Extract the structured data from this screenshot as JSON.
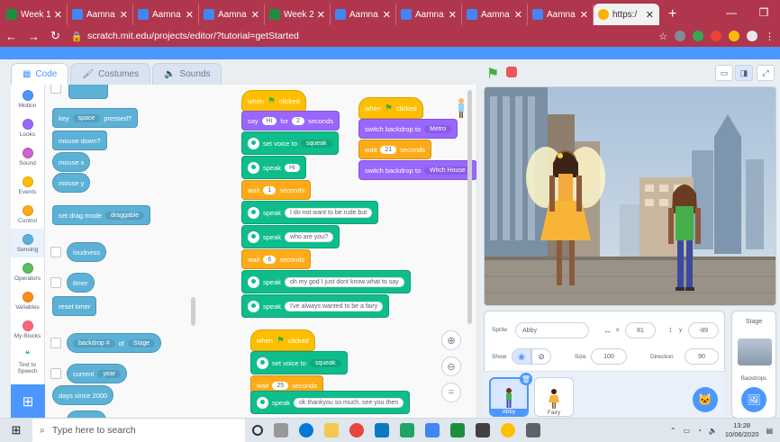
{
  "browser": {
    "tabs": [
      {
        "title": "Week 1",
        "icon": "sheets-icon"
      },
      {
        "title": "Aamna",
        "icon": "docs-icon"
      },
      {
        "title": "Aamna",
        "icon": "docs-icon"
      },
      {
        "title": "Aamna",
        "icon": "docs-icon"
      },
      {
        "title": "Week 2",
        "icon": "sheets-icon"
      },
      {
        "title": "Aamna",
        "icon": "docs-icon"
      },
      {
        "title": "Aamna",
        "icon": "docs-icon"
      },
      {
        "title": "Aamna",
        "icon": "docs-icon"
      },
      {
        "title": "Aamna",
        "icon": "docs-icon"
      },
      {
        "title": "https:/",
        "icon": "scratch-icon",
        "active": true
      }
    ],
    "url": "scratch.mit.edu/projects/editor/?tutorial=getStarted"
  },
  "editor_tabs": {
    "code": "Code",
    "costumes": "Costumes",
    "sounds": "Sounds"
  },
  "categories": [
    {
      "label": "Motion",
      "color": "#4c97ff"
    },
    {
      "label": "Looks",
      "color": "#9966ff"
    },
    {
      "label": "Sound",
      "color": "#cf63cf"
    },
    {
      "label": "Events",
      "color": "#ffbf00"
    },
    {
      "label": "Control",
      "color": "#ffab19"
    },
    {
      "label": "Sensing",
      "color": "#5cb1d6"
    },
    {
      "label": "Operators",
      "color": "#59c059"
    },
    {
      "label": "Variables",
      "color": "#ff8c1a"
    },
    {
      "label": "My Blocks",
      "color": "#ff6680"
    },
    {
      "label": "Text to Speech",
      "color": "#0fbd8c"
    }
  ],
  "palette": {
    "key": "key",
    "key_val": "space",
    "pressed": "pressed?",
    "mouse_down": "mouse down?",
    "mouse_x": "mouse x",
    "mouse_y": "mouse y",
    "set_drag": "set drag mode",
    "drag_val": "draggable",
    "loudness": "loudness",
    "timer": "timer",
    "reset_timer": "reset timer",
    "backdrop_of": "backdrop #",
    "of": "of",
    "stage": "Stage",
    "current": "current",
    "year": "year",
    "days_since": "days since 2000"
  },
  "script1": {
    "hat": "when",
    "clicked": "clicked",
    "say": "say",
    "say_val": "Hi",
    "for": "for",
    "secs": "2",
    "seconds": "seconds",
    "set_voice": "set voice to",
    "voice": "squeak",
    "speak": "speak",
    "speak1": "Hi",
    "wait": "wait",
    "wait1": "1",
    "seconds_lbl": "seconds",
    "speak2": "I do not want to be rude but",
    "speak3": "who are you?",
    "wait2": "6",
    "speak4": "oh my god I just dont know what to say",
    "speak5": "I've always wanted to be a fairy"
  },
  "script2": {
    "hat": "when",
    "clicked": "clicked",
    "switch": "switch backdrop to",
    "bd1": "Metro",
    "wait": "wait",
    "wait1": "21",
    "seconds": "seconds",
    "bd2": "Witch House"
  },
  "script3": {
    "hat": "when",
    "clicked": "clicked",
    "set_voice": "set voice to",
    "voice": "squeak",
    "wait": "wait",
    "wait1": "25",
    "seconds": "seconds",
    "speak": "speak",
    "speak1": "ok thankyou so much. see you then"
  },
  "sprite_info": {
    "sprite_label": "Sprite",
    "name": "Abby",
    "x_label": "x",
    "x": "81",
    "y_label": "y",
    "y": "-89",
    "show_label": "Show",
    "size_label": "Size",
    "size": "100",
    "direction_label": "Direction",
    "direction": "90"
  },
  "sprites": [
    {
      "name": "Abby"
    },
    {
      "name": "Fairy"
    }
  ],
  "stage_col": {
    "title": "Stage",
    "backdrops": "Backdrops"
  },
  "taskbar": {
    "search_placeholder": "Type here to search",
    "time": "13:28",
    "date": "10/06/2020"
  }
}
